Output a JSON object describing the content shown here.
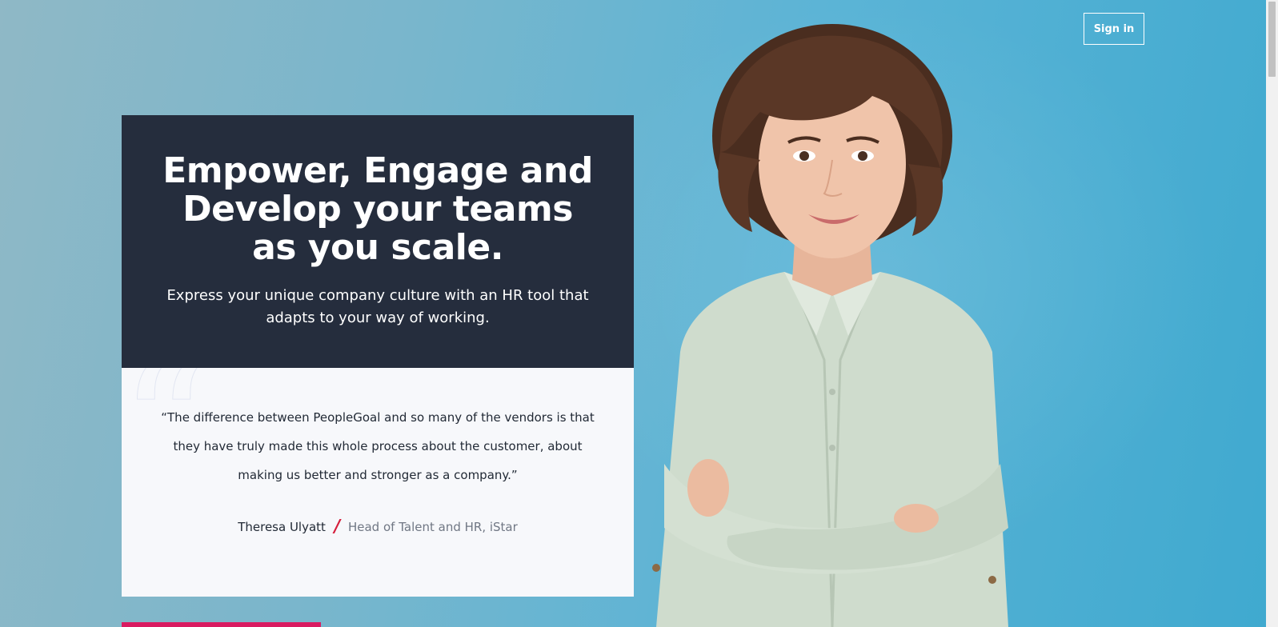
{
  "header": {
    "signin_label": "Sign in"
  },
  "hero": {
    "title": "Empower, Engage and Develop your teams as you scale.",
    "subtitle": "Express your unique company culture with an HR tool that adapts to your way of working."
  },
  "testimonial": {
    "quote": "“The difference between PeopleGoal and so many of the vendors is that they have truly made this whole process about the customer, about making us better and stronger as a company.”",
    "author_name": "Theresa Ulyatt",
    "separator": "/",
    "author_role": "Head of Talent and HR, iStar"
  },
  "colors": {
    "hero_bg": "#252d3d",
    "quote_bg": "#f7f8fb",
    "accent_red": "#d51e3c",
    "cta_pink": "#d91b61",
    "background_blue": "#5bb4d6"
  },
  "icons": {
    "quote_mark": "quote-icon"
  }
}
